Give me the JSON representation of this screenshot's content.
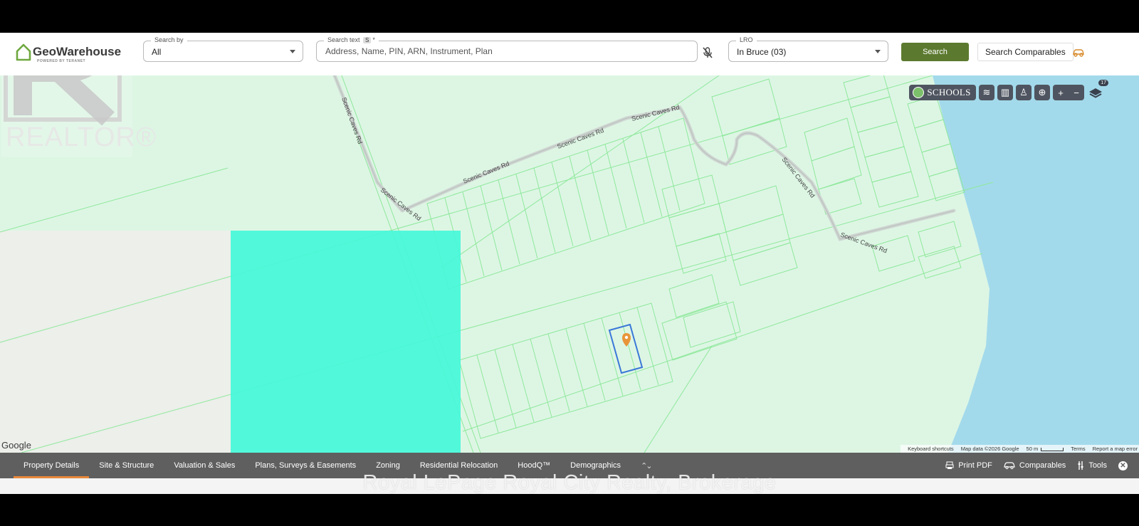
{
  "header": {
    "logo_text": "GeoWarehouse",
    "logo_tagline": "POWERED BY TERANET",
    "search_by": {
      "label": "Search by",
      "value": "All"
    },
    "search_text": {
      "label": "Search text",
      "badge": "S",
      "required_mark": "*",
      "placeholder": "Address, Name, PIN, ARN, Instrument, Plan"
    },
    "lro": {
      "label": "LRO",
      "value": "In Bruce (03)"
    },
    "search_button": "Search",
    "search_comparables_button": "Search Comparables"
  },
  "map": {
    "schools_label": "SCHOOLS",
    "layers_count": "17",
    "road_labels": [
      "Scenic Caves Rd",
      "Scenic Caves Rd",
      "Scenic Caves Rd",
      "Scenic Caves Rd",
      "Scenic Caves Rd",
      "Scenic Caves Rd",
      "Scenic Caves Rd"
    ],
    "google_logo": "Google",
    "attribution": {
      "shortcuts": "Keyboard shortcuts",
      "map_data": "Map data ©2026 Google",
      "scale": "50 m",
      "terms": "Terms",
      "report": "Report a map error"
    },
    "colors": {
      "land": "#ddf6e4",
      "water": "#a3daeb",
      "parcel_lines": "#8fe89c",
      "highlight": "#45f7d9",
      "selected_parcel": "#3a78d8",
      "pin": "#e8953a"
    }
  },
  "watermarks": {
    "realtor": "REALTOR®",
    "brokerage": "Royal LePage Royal City Realty, Brokerage"
  },
  "tabs": [
    {
      "label": "Property Details",
      "active": true
    },
    {
      "label": "Site & Structure",
      "active": false
    },
    {
      "label": "Valuation & Sales",
      "active": false
    },
    {
      "label": "Plans, Surveys & Easements",
      "active": false
    },
    {
      "label": "Zoning",
      "active": false
    },
    {
      "label": "Residential Relocation",
      "active": false
    },
    {
      "label": "HoodQ™",
      "active": false
    },
    {
      "label": "Demographics",
      "active": false
    }
  ],
  "tools": {
    "print_pdf": "Print PDF",
    "comparables": "Comparables",
    "tools": "Tools"
  }
}
